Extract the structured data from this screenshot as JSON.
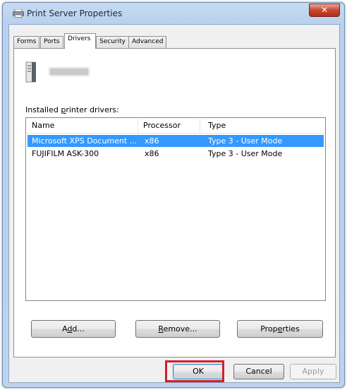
{
  "window": {
    "title": "Print Server Properties",
    "close_glyph": "✕",
    "icon": "printer-icon"
  },
  "tabs": [
    {
      "label": "Forms",
      "active": false
    },
    {
      "label": "Ports",
      "active": false
    },
    {
      "label": "Drivers",
      "active": true
    },
    {
      "label": "Security",
      "active": false
    },
    {
      "label": "Advanced",
      "active": false
    }
  ],
  "server": {
    "icon": "server-tower-icon"
  },
  "drivers": {
    "label_pre": "Installed ",
    "label_key": "p",
    "label_post": "rinter drivers:",
    "columns": [
      "Name",
      "Processor",
      "Type"
    ],
    "rows": [
      {
        "name": "Microsoft XPS Document ...",
        "processor": "x86",
        "type": "Type 3 - User Mode",
        "selected": true
      },
      {
        "name": "FUJIFILM ASK-300",
        "processor": "x86",
        "type": "Type 3 - User Mode",
        "selected": false
      }
    ]
  },
  "buttons": {
    "add": {
      "pre": "A",
      "key": "d",
      "post": "d..."
    },
    "remove": {
      "pre": "",
      "key": "R",
      "post": "emove..."
    },
    "properties": {
      "pre": "Prop",
      "key": "e",
      "post": "rties"
    },
    "ok": "OK",
    "cancel": "Cancel",
    "apply": "Apply"
  },
  "colors": {
    "selection": "#3399ff",
    "highlight_box": "#d01f2b"
  }
}
